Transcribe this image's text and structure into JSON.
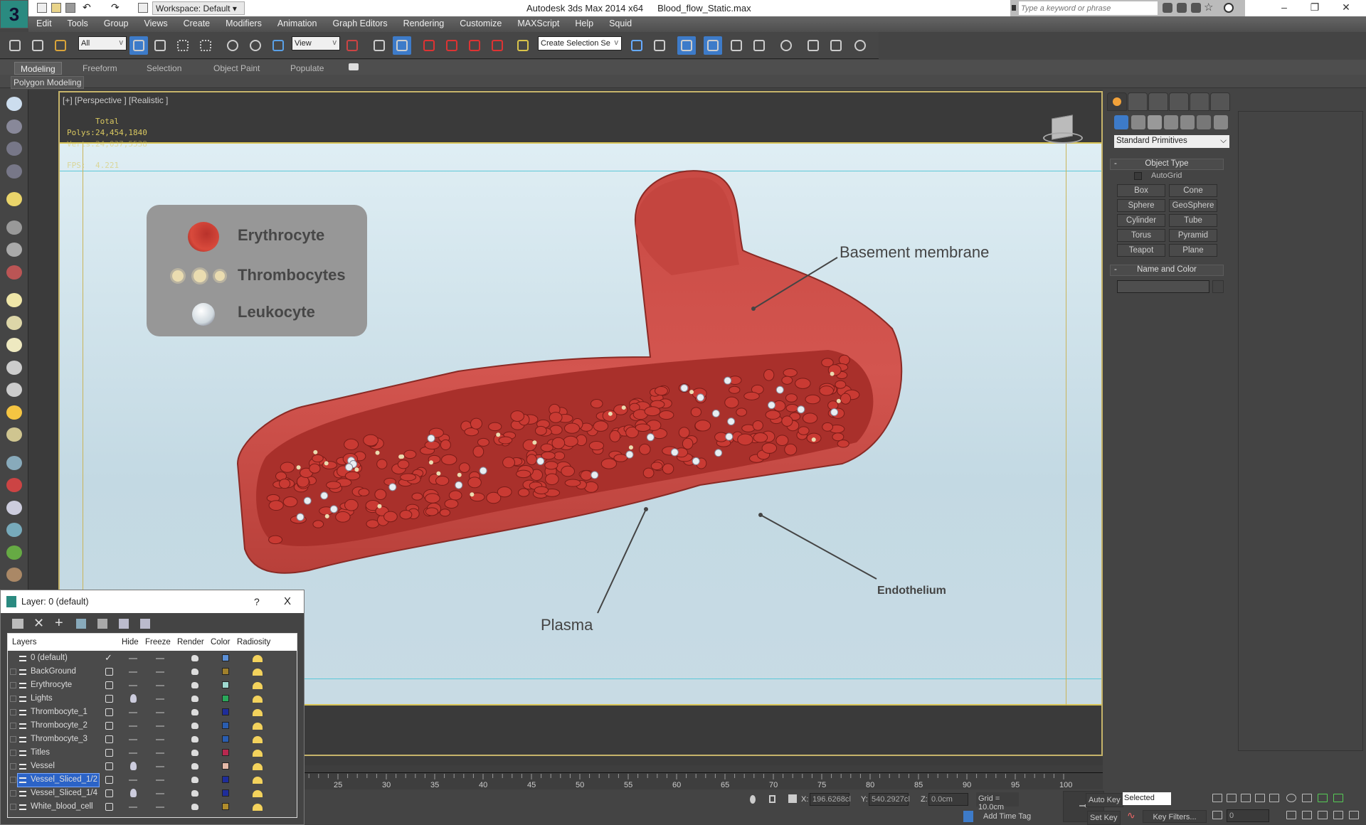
{
  "titlebar": {
    "workspace": "Workspace: Default",
    "app": "Autodesk 3ds Max  2014 x64",
    "file": "Blood_flow_Static.max",
    "search_placeholder": "Type a keyword or phrase"
  },
  "menu": [
    "Edit",
    "Tools",
    "Group",
    "Views",
    "Create",
    "Modifiers",
    "Animation",
    "Graph Editors",
    "Rendering",
    "Customize",
    "MAXScript",
    "Help",
    "Squid"
  ],
  "toolbar": {
    "filter": "All",
    "refcoord": "View",
    "selection_set": "Create Selection Se"
  },
  "ribbon": {
    "tabs": [
      "Modeling",
      "Freeform",
      "Selection",
      "Object Paint",
      "Populate"
    ],
    "active": "Modeling",
    "panel": "Polygon Modeling"
  },
  "viewport": {
    "label": "[+] [Perspective ] [Realistic ]",
    "stats": {
      "header": "Total",
      "polys_label": "Polys:",
      "polys": "24,454,1840",
      "verts_label": "Verts:",
      "verts": "24,037,5538",
      "fps_label": "FPS:",
      "fps": "4.221"
    }
  },
  "scene": {
    "legend": [
      "Erythrocyte",
      "Thrombocytes",
      "Leukocyte"
    ],
    "callouts": {
      "basement": "Basement membrane",
      "endothelium": "Endothelium",
      "plasma": "Plasma"
    },
    "colors": {
      "vessel": "#d3554f",
      "erythrocyte": "#c93a33",
      "leukocyte": "#e8eef2",
      "thrombocyte": "#eadcb0"
    }
  },
  "command_panel": {
    "dropdown": "Standard Primitives",
    "object_type": "Object Type",
    "autogrid": "AutoGrid",
    "buttons": [
      "Box",
      "Cone",
      "Sphere",
      "GeoSphere",
      "Cylinder",
      "Tube",
      "Torus",
      "Pyramid",
      "Teapot",
      "Plane"
    ],
    "name_color": "Name and Color"
  },
  "layer_dialog": {
    "title": "Layer: 0 (default)",
    "help": "?",
    "close": "X",
    "columns": [
      "Layers",
      "Hide",
      "Freeze",
      "Render",
      "Color",
      "Radiosity"
    ],
    "layers": [
      {
        "name": "0 (default)",
        "active": true,
        "hidden_bulb": false,
        "color": "#5b8fd6",
        "expand": false
      },
      {
        "name": "BackGround",
        "active": false,
        "hidden_bulb": false,
        "color": "#a0802c"
      },
      {
        "name": "Erythrocyte",
        "active": false,
        "hidden_bulb": false,
        "color": "#9fd9d0"
      },
      {
        "name": "Lights",
        "active": false,
        "hidden_bulb": true,
        "color": "#2aa85a"
      },
      {
        "name": "Thrombocyte_1",
        "active": false,
        "hidden_bulb": false,
        "color": "#1e2d9a"
      },
      {
        "name": "Thrombocyte_2",
        "active": false,
        "hidden_bulb": false,
        "color": "#2a5db0"
      },
      {
        "name": "Thrombocyte_3",
        "active": false,
        "hidden_bulb": false,
        "color": "#2a5db0"
      },
      {
        "name": "Titles",
        "active": false,
        "hidden_bulb": false,
        "color": "#b8284f"
      },
      {
        "name": "Vessel",
        "active": false,
        "hidden_bulb": true,
        "color": "#e4b9a8"
      },
      {
        "name": "Vessel_Sliced_1/2",
        "active": false,
        "hidden_bulb": false,
        "color": "#1e2d9a",
        "selected": true
      },
      {
        "name": "Vessel_Sliced_1/4",
        "active": false,
        "hidden_bulb": true,
        "color": "#1e2d9a"
      },
      {
        "name": "White_blood_cell",
        "active": false,
        "hidden_bulb": false,
        "color": "#b08c2c"
      }
    ]
  },
  "timeline": {
    "start": 0,
    "end": 100,
    "step": 5
  },
  "status": {
    "x_label": "X:",
    "x": "196.6268cl",
    "y_label": "Y:",
    "y": "540.2927cl",
    "z_label": "Z:",
    "z": "0.0cm",
    "grid": "Grid = 10.0cm",
    "add_time_tag": "Add Time Tag",
    "auto_key": "Auto Key",
    "set_key": "Set Key",
    "key_mode": "Selected",
    "key_filters": "Key Filters...",
    "frame": "0"
  }
}
